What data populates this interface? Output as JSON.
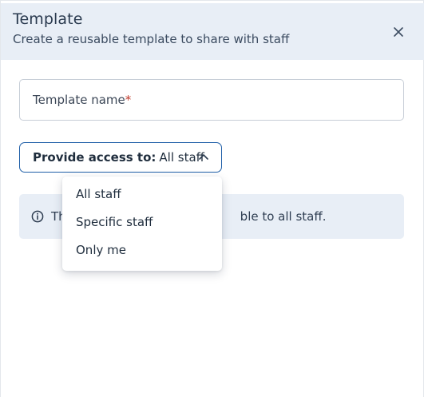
{
  "header": {
    "title": "Template",
    "subtitle": "Create a reusable template to share with staff"
  },
  "name_field": {
    "label": "Template name",
    "required_marker": "*"
  },
  "access": {
    "prefix": "Provide access to:",
    "selected": "All staff",
    "options": [
      "All staff",
      "Specific staff",
      "Only me"
    ]
  },
  "info": {
    "text_visible_left": "Th",
    "text_visible_right": "ble to all staff."
  },
  "icons": {
    "close": "close-icon",
    "chevron": "chevron-up-icon",
    "info": "info-icon"
  },
  "colors": {
    "header_bg": "#e8eef6",
    "accent": "#1f5fa8",
    "required": "#c0392b"
  }
}
